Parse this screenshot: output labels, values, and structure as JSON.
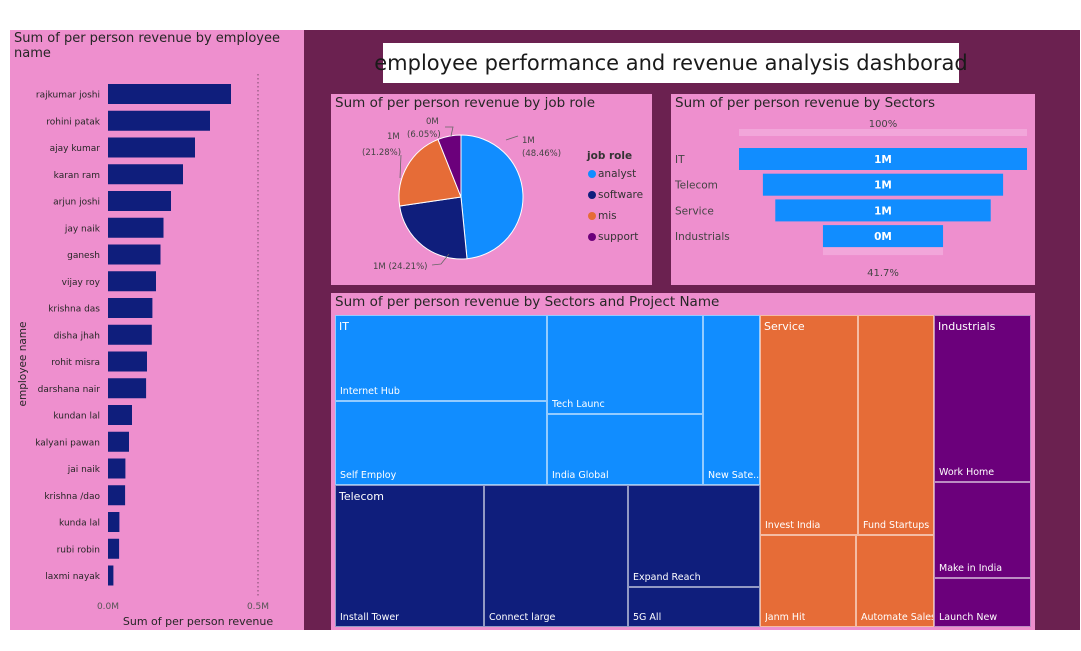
{
  "dashboard_title": "employee performance and revenue analysis dashborad",
  "colors": {
    "navy": "#0f1e7c",
    "blue": "#118dff",
    "orange": "#e66c37",
    "purple": "#6b007b",
    "pink": "#ee8fce",
    "plum": "#6b2150"
  },
  "chart_data": [
    {
      "type": "bar",
      "orientation": "horizontal",
      "title": "Sum of per person revenue by employee name",
      "ylabel": "employee name",
      "xlabel": "Sum of per person revenue",
      "xticks": [
        "0.0M",
        "0.5M"
      ],
      "xlim": [
        0,
        0.5
      ],
      "categories": [
        "rajkumar joshi",
        "rohini patak",
        "ajay kumar",
        "karan ram",
        "arjun joshi",
        "jay naik",
        "ganesh",
        "vijay roy",
        "krishna das",
        "disha jhah",
        "rohit misra",
        "darshana nair",
        "kundan lal",
        "kalyani pawan",
        "jai naik",
        "krishna /dao",
        "kunda lal",
        "rubi robin",
        "laxmi nayak"
      ],
      "values": [
        0.41,
        0.34,
        0.29,
        0.25,
        0.21,
        0.185,
        0.175,
        0.16,
        0.148,
        0.146,
        0.13,
        0.127,
        0.08,
        0.07,
        0.058,
        0.057,
        0.038,
        0.037,
        0.018
      ]
    },
    {
      "type": "pie",
      "title": "Sum of per person revenue by job role",
      "legend_title": "job role",
      "categories": [
        "analyst",
        "software",
        "mis",
        "support"
      ],
      "values": [
        48.46,
        24.21,
        21.28,
        6.05
      ],
      "labels": [
        "1M (48.46%)",
        "1M (24.21%)",
        "1M (21.28%)",
        "0M (6.05%)"
      ]
    },
    {
      "type": "funnel",
      "title": "Sum of per person revenue by Sectors",
      "categories": [
        "IT",
        "Telecom",
        "Service",
        "Industrials"
      ],
      "values": [
        100,
        83.4,
        74.8,
        41.7
      ],
      "labels": [
        "1M",
        "1M",
        "1M",
        "0M"
      ],
      "top_pct": "100%",
      "bottom_pct": "41.7%"
    },
    {
      "type": "treemap",
      "title": "Sum of per person revenue by Sectors and Project Name",
      "groups": [
        {
          "name": "IT",
          "items": [
            "Internet Hub",
            "Self Employ",
            "Tech Launc",
            "India Global",
            "New Sate..."
          ]
        },
        {
          "name": "Telecom",
          "items": [
            "Install Tower",
            "Connect large",
            "Expand Reach",
            "5G All"
          ]
        },
        {
          "name": "Service",
          "items": [
            "Invest India",
            "Fund Startups",
            "Janm Hit",
            "Automate Sales"
          ]
        },
        {
          "name": "Industrials",
          "items": [
            "Work Home",
            "Make in India",
            "Launch New"
          ]
        }
      ]
    }
  ]
}
